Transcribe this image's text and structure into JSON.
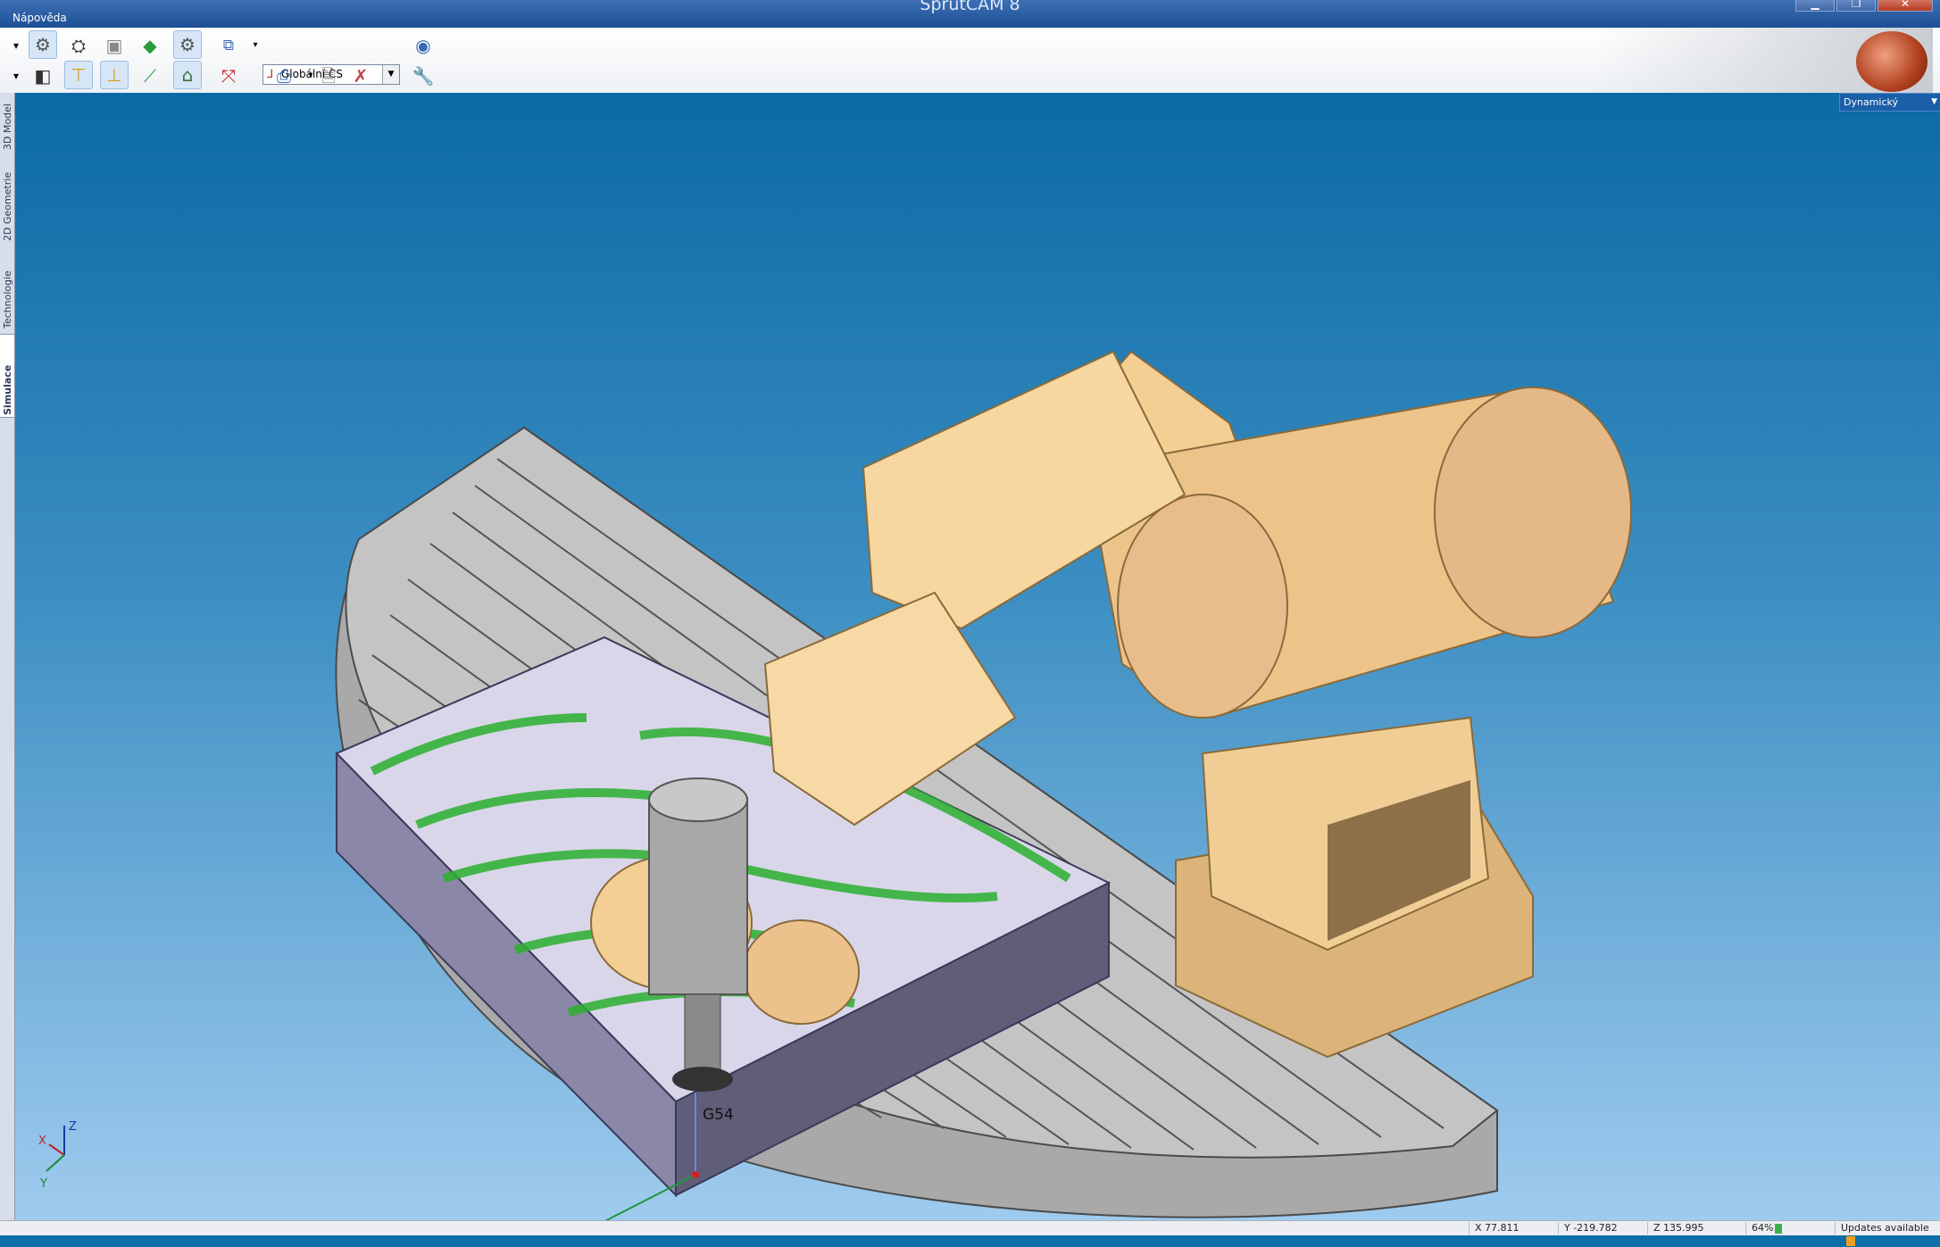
{
  "window": {
    "title": "SprutCAM 8",
    "menu_help": "Nápověda",
    "btn_min": "▁",
    "btn_max": "❐",
    "btn_close": "✕"
  },
  "toolbar": {
    "coord_system": "Globální CS",
    "icons": [
      "machine-icon",
      "tool-icon",
      "workpiece-icon",
      "fixture-icon",
      "part-icon",
      "machine-ok-icon",
      "setup-icon",
      "tool-holder-icon",
      "tool-library-icon",
      "toolpath-icon",
      "operation-icon",
      "layer-icon",
      "pdf-icon",
      "print-preview-icon",
      "delete-report-icon",
      "simulate-icon",
      "wrench-icon",
      "axis-arrow-icon"
    ]
  },
  "view_mode": "Dynamický",
  "side_tabs": [
    "3D Model",
    "2D Geometrie",
    "Technologie",
    "Simulace"
  ],
  "active_side_tab": "Simulace",
  "viewport": {
    "workpiece_cs_label": "G54",
    "triad_labels": {
      "x": "X",
      "y": "Y",
      "z": "Z"
    }
  },
  "status": {
    "x": "X 77.811",
    "y": "Y -219.782",
    "z": "Z 135.995",
    "memory": "64%",
    "updates": "Updates available"
  },
  "colors": {
    "robot": "#f3cf94",
    "table": "#b9b9b9",
    "stock": "#8a87a8",
    "toolpath": "#2bb02f",
    "bg_top": "#0b6aa4",
    "bg_bottom": "#9fcbee"
  }
}
